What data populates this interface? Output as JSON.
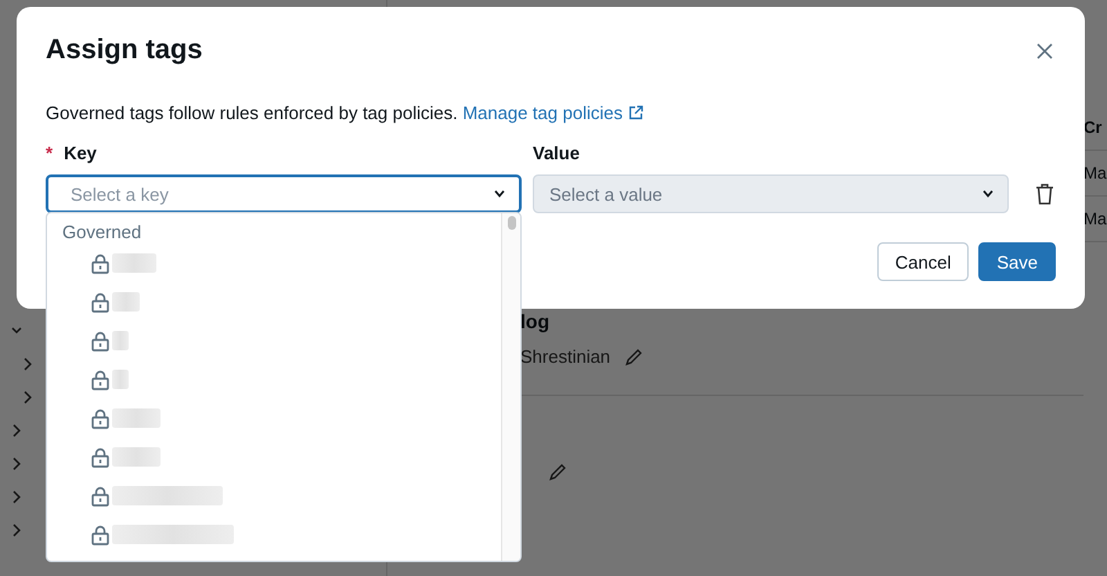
{
  "background": {
    "section_title": "log",
    "owner": "Shrestinian",
    "table_column": "Cr",
    "table_rows": [
      "Ma",
      "Ma"
    ]
  },
  "dialog": {
    "title": "Assign tags",
    "description": "Governed tags follow rules enforced by tag policies.",
    "link": "Manage tag policies",
    "key_label": "Key",
    "required_mark": "*",
    "key_placeholder": "Select a key",
    "value_label": "Value",
    "value_placeholder": "Select a value",
    "value_disabled": true,
    "buttons": [
      {
        "label": "Cancel",
        "kind": "secondary"
      },
      {
        "label": "Save",
        "kind": "primary"
      }
    ]
  },
  "key_dropdown": {
    "group": "Governed",
    "items": [
      {
        "locked": true
      },
      {
        "locked": true
      },
      {
        "locked": true
      },
      {
        "locked": true
      },
      {
        "locked": true
      },
      {
        "locked": true
      },
      {
        "locked": true
      },
      {
        "locked": true
      }
    ]
  }
}
